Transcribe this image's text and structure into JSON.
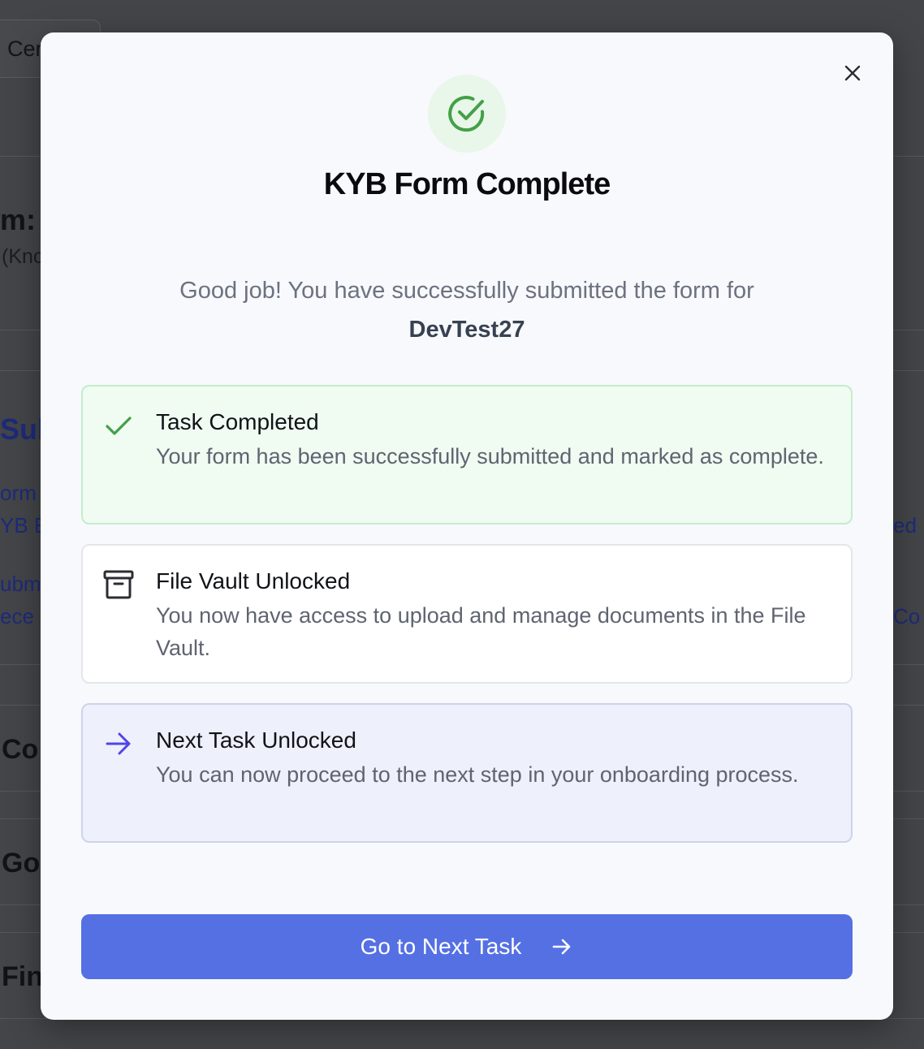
{
  "background": {
    "certificate_button": "Cer",
    "heading_fragment": "m: U",
    "subtitle_fragment": "(Kno",
    "section_fragment": "Sub",
    "link1a": "orm",
    "link1b": "YB E",
    "link2a": "ubm",
    "link2b": "ece",
    "right1": "ed",
    "right2": "Co",
    "row1": "Co",
    "row2": "Go",
    "row3": "Fin"
  },
  "modal": {
    "title": "KYB Form Complete",
    "description": "Good job! You have successfully submitted the form for",
    "company_name": "DevTest27",
    "cards": [
      {
        "icon": "check-icon",
        "title": "Task Completed",
        "body": "Your form has been successfully submitted and marked as complete."
      },
      {
        "icon": "archive-icon",
        "title": "File Vault Unlocked",
        "body": "You now have access to upload and manage documents in the File Vault."
      },
      {
        "icon": "arrow-right-icon",
        "title": "Next Task Unlocked",
        "body": "You can now proceed to the next step in your onboarding process."
      }
    ],
    "primary_button": "Go to Next Task"
  },
  "colors": {
    "success": "#43a047",
    "primary": "#5570e3",
    "indigo_icon": "#4f46e5"
  }
}
